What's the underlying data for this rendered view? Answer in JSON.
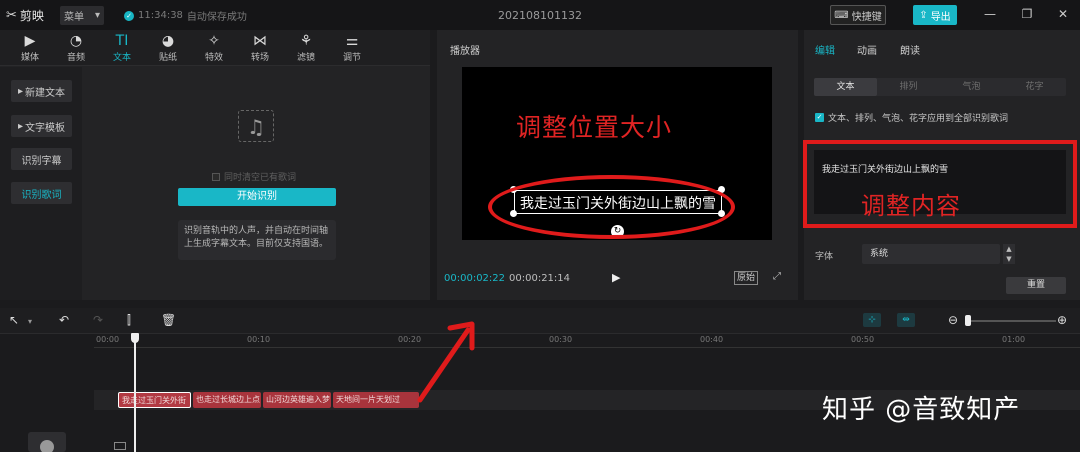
{
  "app": {
    "name": "剪映",
    "menu": "菜单",
    "save_time": "11:34:38",
    "save_status": "自动保存成功",
    "project_title": "202108101132",
    "shortcut_label": "快捷键",
    "export_label": "导出"
  },
  "left_tabs": [
    {
      "label": "媒体",
      "icon": "media-icon"
    },
    {
      "label": "音频",
      "icon": "audio-icon"
    },
    {
      "label": "文本",
      "icon": "text-icon",
      "glyph": "TI"
    },
    {
      "label": "贴纸",
      "icon": "sticker-icon"
    },
    {
      "label": "特效",
      "icon": "effects-icon"
    },
    {
      "label": "转场",
      "icon": "transition-icon"
    },
    {
      "label": "滤镜",
      "icon": "filter-icon"
    },
    {
      "label": "调节",
      "icon": "adjust-icon"
    }
  ],
  "side_buttons": [
    "新建文本",
    "文字模板",
    "识别字幕",
    "识别歌词"
  ],
  "lyrics": {
    "clear_option": "同时清空已有歌词",
    "start_button": "开始识别",
    "description": "识别音轨中的人声，并自动在时间轴上生成字幕文本。目前仅支持国语。"
  },
  "player": {
    "title": "播放器",
    "annotation": "调整位置大小",
    "subtitle": "我走过玉门关外街边山上飘的雪",
    "time_current": "00:00:02:22",
    "time_total": "00:00:21:14",
    "original_label": "原始"
  },
  "right_panel": {
    "tabs": [
      "编辑",
      "动画",
      "朗读"
    ],
    "subtabs": [
      "文本",
      "排列",
      "气泡",
      "花字"
    ],
    "apply_all": "文本、排列、气泡、花字应用到全部识别歌词",
    "text_value": "我走过玉门关外街边山上飘的雪",
    "annotation": "调整内容",
    "font_label": "字体",
    "font_value": "系统",
    "reset_label": "重置"
  },
  "timeline": {
    "ticks": [
      "00:00",
      "00:10",
      "00:20",
      "00:30",
      "00:40",
      "00:50",
      "01:00"
    ],
    "clips": [
      "我走过玉门关外街",
      "也走过长城边上点",
      "山河边英雄遍入梦",
      "天地间一片天划过"
    ]
  },
  "watermark": "知乎 @音致知产",
  "colors": {
    "accent": "#19b7c7",
    "annotation_red": "#e01b1b",
    "clip": "#a8343c"
  }
}
